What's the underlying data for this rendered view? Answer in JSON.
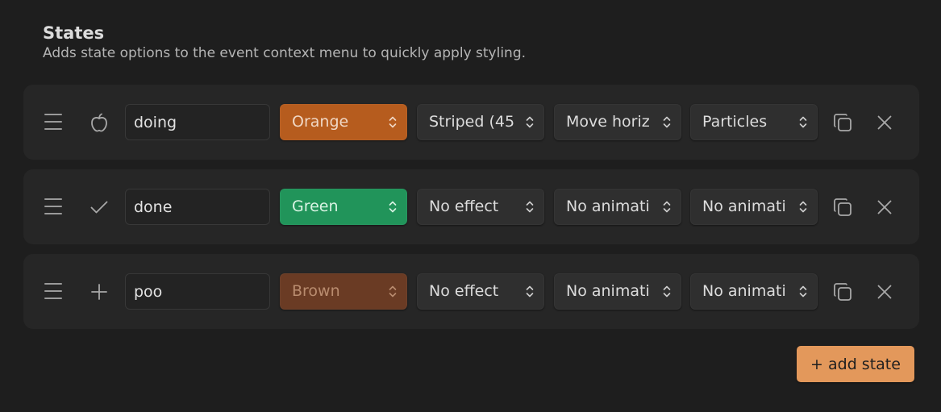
{
  "section": {
    "title": "States",
    "description": "Adds state options to the event context menu to quickly apply styling."
  },
  "states": [
    {
      "icon": "apple-icon",
      "name": "doing",
      "color": {
        "label": "Orange",
        "bg": "#b65c1e",
        "text": "#f0d7c4"
      },
      "effect": "Striped (45",
      "animation": "Move horiz",
      "animation2": "Particles"
    },
    {
      "icon": "check-icon",
      "name": "done",
      "color": {
        "label": "Green",
        "bg": "#21945a",
        "text": "#d9f3e3"
      },
      "effect": "No effect",
      "animation": "No animati",
      "animation2": "No animati"
    },
    {
      "icon": "plus-icon",
      "name": "poo",
      "color": {
        "label": "Brown",
        "bg": "#6a3b24",
        "text": "#b98c6f"
      },
      "effect": "No effect",
      "animation": "No animati",
      "animation2": "No animati"
    }
  ],
  "add_button": {
    "label": "+ add state",
    "bg": "#e3985b"
  }
}
